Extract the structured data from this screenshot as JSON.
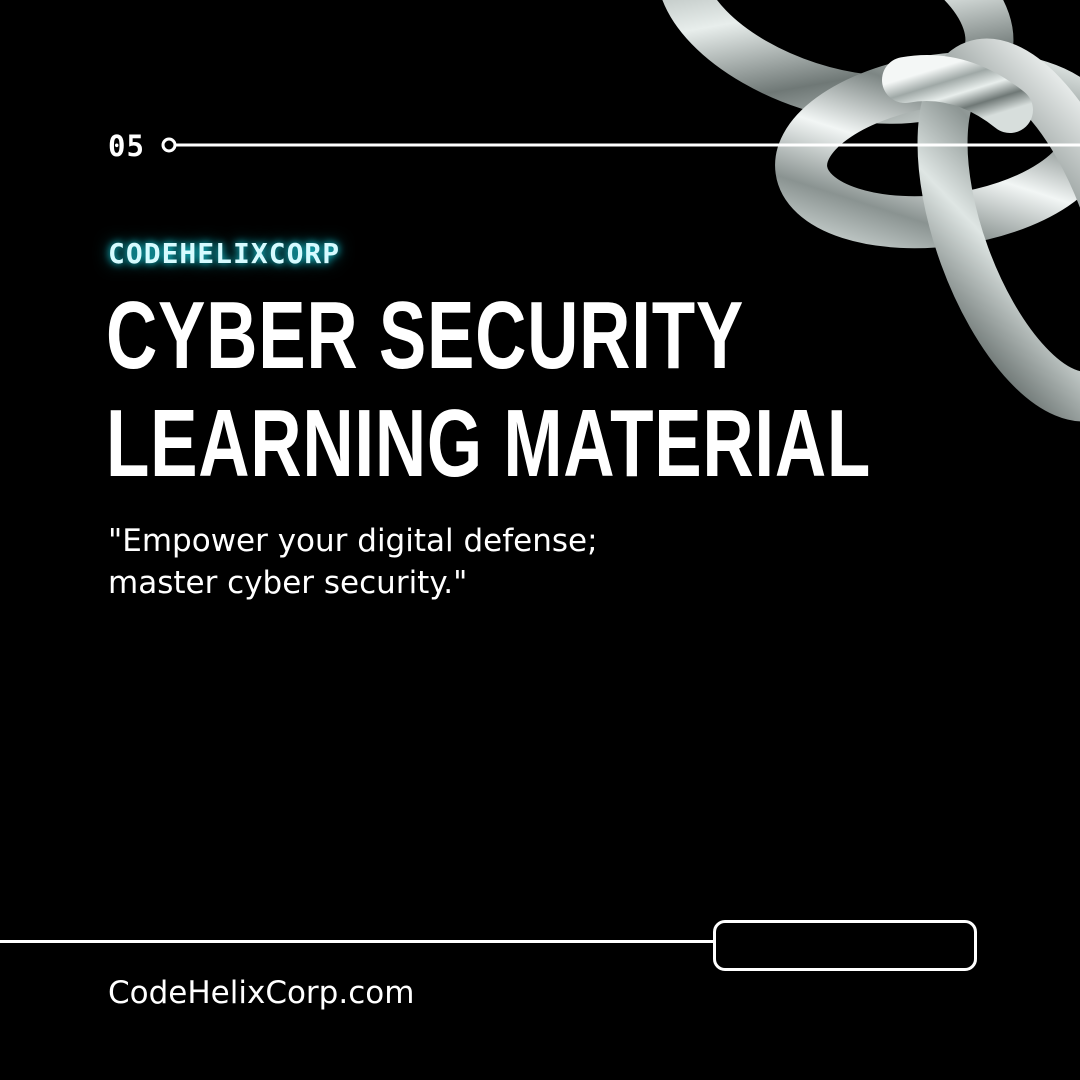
{
  "slide": {
    "number": "05",
    "brand": "CODEHELIXCORP",
    "headline_lines": [
      "CYBER SECURITY",
      "LEARNING MATERIAL"
    ],
    "quote_lines": [
      "\"Empower your digital defense;",
      "master cyber security.\""
    ],
    "website": "CodeHelixCorp.com"
  },
  "decoration": {
    "image": "metallic-chain-links",
    "background_color": "#000000",
    "brand_glow_color": "#19dceb",
    "text_color": "#ffffff"
  }
}
